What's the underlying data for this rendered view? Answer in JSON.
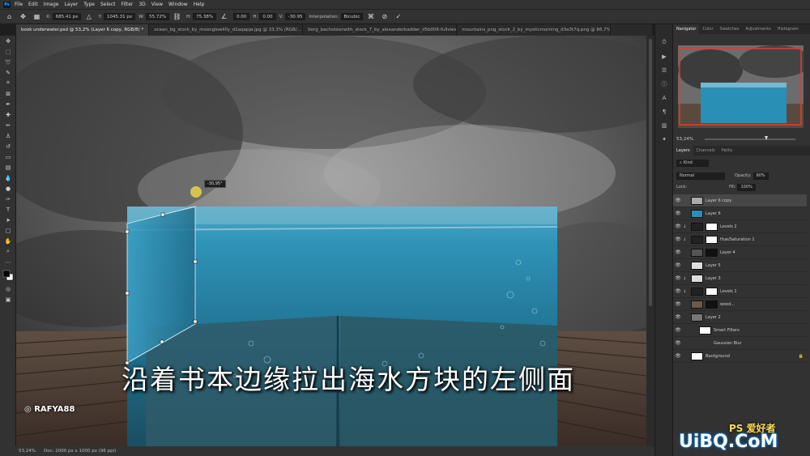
{
  "app": {
    "logo": "Ps"
  },
  "menu": [
    "File",
    "Edit",
    "Image",
    "Layer",
    "Type",
    "Select",
    "Filter",
    "3D",
    "View",
    "Window",
    "Help"
  ],
  "options": {
    "x_label": "X:",
    "x_value": "685.41 px",
    "y_label": "Y:",
    "y_value": "1045.31 px",
    "w_label": "W:",
    "w_value": "55.72%",
    "h_label": "H:",
    "h_value": "75.38%",
    "angle_value": "0.00",
    "hskew_label": "H:",
    "hskew_value": "0.00",
    "vskew_label": "V:",
    "vskew_value": "-30.95",
    "interp_label": "Interpolation:",
    "interp_value": "Bicubic"
  },
  "tabs": [
    "book underwater.psd @ 53,2% (Layer 6 copy, RGB/8) *",
    "ocean_bg_stock_by_moonglowlilly_d1aqapja.jpg @ 33,3% (RGB/...",
    "borg_bachsisterwith_stock_7_by_alexanderbadder_d5b006-fullview.jpg",
    "mountains_png_stock_2_by_mysticmorning_d3a3t7q.png @ 66,7%"
  ],
  "transform_readout": "-30,95°",
  "status": {
    "zoom": "53,24%",
    "doc": "Doc: 2000 px x 1000 px (96 ppi)"
  },
  "panel": {
    "top_tabs": [
      "Navigator",
      "Color",
      "Swatches",
      "Adjustments",
      "Histogram"
    ],
    "nav_zoom": "53,24%",
    "layer_tabs": [
      "Layers",
      "Channels",
      "Paths"
    ],
    "kind_label": "Kind",
    "blend_mode": "Normal",
    "opacity_label": "Opacity:",
    "opacity_value": "60%",
    "lock_label": "Lock:",
    "fill_label": "Fill:",
    "fill_value": "100%"
  },
  "layers": [
    {
      "name": "Layer 6 copy",
      "selected": true
    },
    {
      "name": "Layer 6",
      "selected": false
    },
    {
      "name": "Levels 2",
      "selected": false
    },
    {
      "name": "Hue/Saturation 1",
      "selected": false
    },
    {
      "name": "Layer 4",
      "selected": false
    },
    {
      "name": "Layer 5",
      "selected": false
    },
    {
      "name": "Layer 3",
      "selected": false
    },
    {
      "name": "Levels 1",
      "selected": false
    },
    {
      "name": "wood...",
      "selected": false
    },
    {
      "name": "Layer 2",
      "selected": false
    },
    {
      "name": "Smart Filters",
      "selected": false
    },
    {
      "name": "Gaussian Blur",
      "selected": false
    },
    {
      "name": "Background",
      "selected": false
    }
  ],
  "subtitle": "沿着书本边缘拉出海水方块的左侧面",
  "watermark": "RAFYA88",
  "site_logo": "UiBQ.CoM",
  "site_logo_cn": "PS 爱好者",
  "colors": {
    "water": "#2a8fb4",
    "sky": "#6b6b6b",
    "wood": "#6e5a4a",
    "accent": "#31a8ff"
  }
}
